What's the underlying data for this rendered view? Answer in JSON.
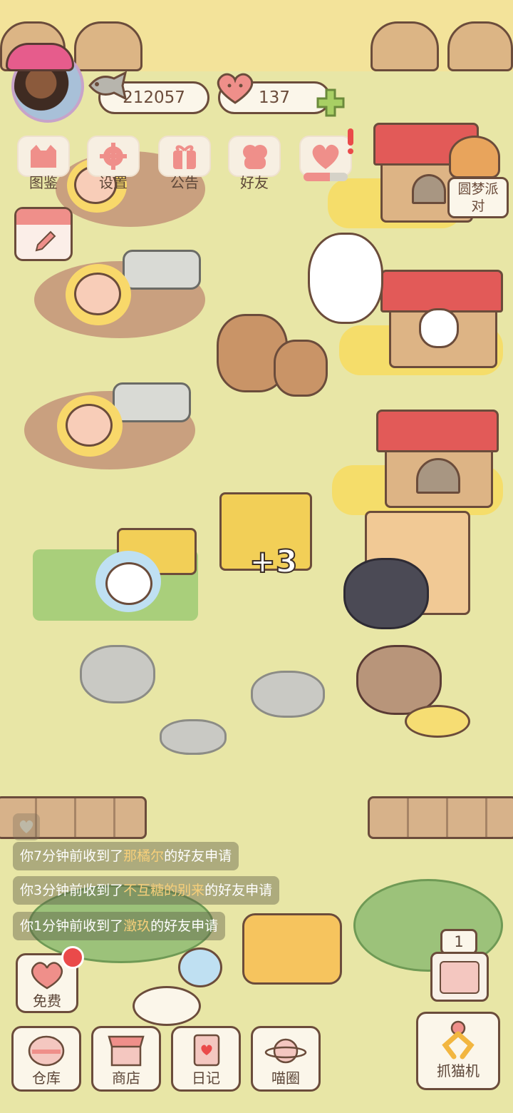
{
  "hud": {
    "fish_count": "212057",
    "heart_count": "137"
  },
  "menu": [
    {
      "label": "图鉴",
      "icon": "cat-book-icon"
    },
    {
      "label": "设置",
      "icon": "gear-icon"
    },
    {
      "label": "公告",
      "icon": "gift-icon"
    },
    {
      "label": "好友",
      "icon": "friends-icon"
    },
    {
      "label": "",
      "icon": "heart-gift-icon"
    }
  ],
  "party_event": {
    "label_line1": "圆梦派",
    "label_line2": "对"
  },
  "scene": {
    "reward_text": "+3"
  },
  "notifications": [
    {
      "prefix": "你7分钟前收到了",
      "name": "那橘尔",
      "suffix": "的好友申请"
    },
    {
      "prefix": "你3分钟前收到了",
      "name": "不互糖的别来",
      "suffix": "的好友申请"
    },
    {
      "prefix": "你1分钟前收到了",
      "name": "澂玖",
      "suffix": "的好友申请"
    }
  ],
  "bottom": {
    "free_label": "免费",
    "warehouse_label": "仓库",
    "shop_label": "商店",
    "diary_label": "日记",
    "circle_label": "喵圈",
    "claw_label": "抓猫机",
    "claw_count": "1"
  },
  "colors": {
    "grass": "#e8e6a6",
    "outline": "#6b4c3b",
    "accent_pink": "#ef8f8a",
    "badge_red": "#ea4a4a"
  }
}
